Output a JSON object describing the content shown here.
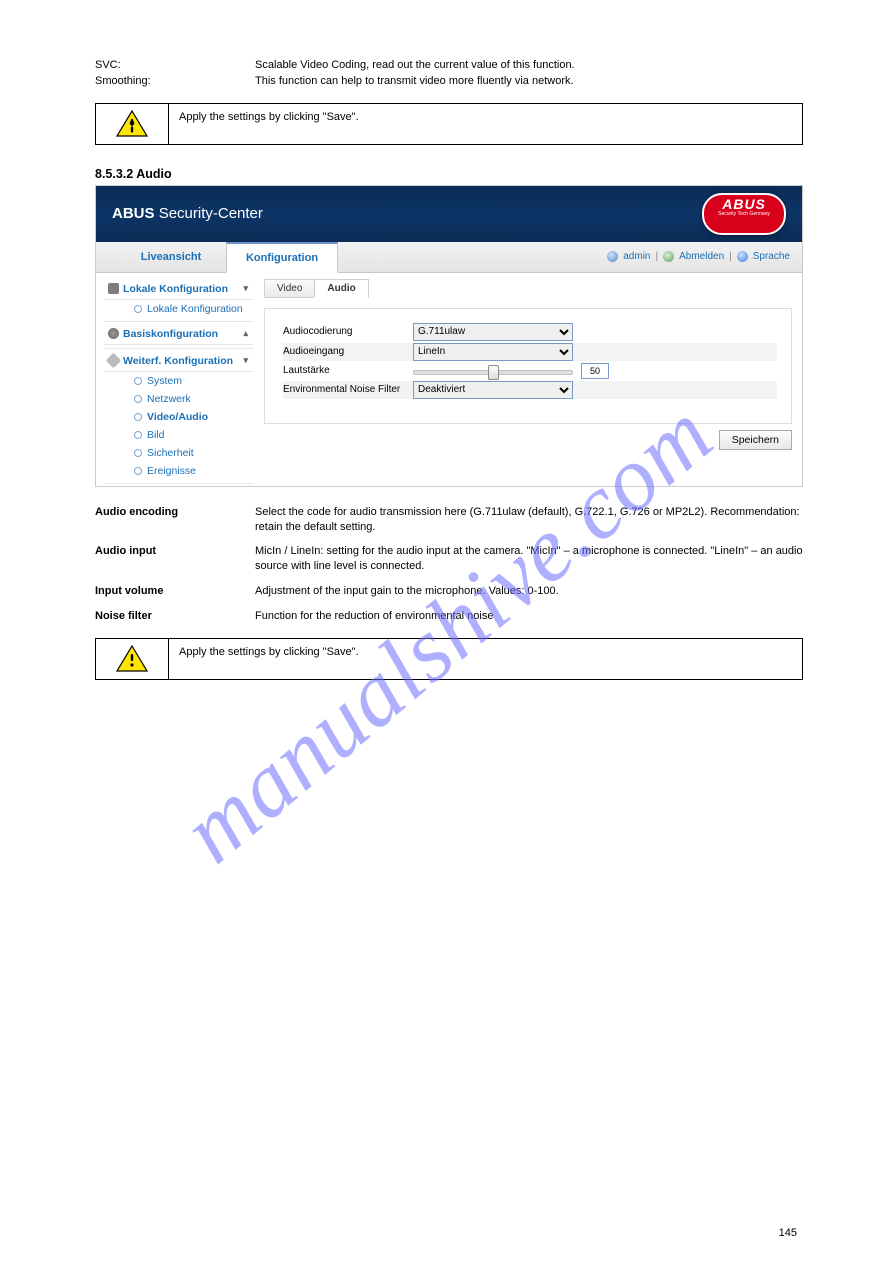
{
  "watermark": "manualshive.com",
  "top": {
    "smo": {
      "label": "SVC:",
      "value": "Scalable Video Coding, read out the current value of this function."
    },
    "smoothing": {
      "label": "Smoothing:",
      "value": "This function can help to transmit video more fluently via network."
    }
  },
  "note1": "Apply the settings by clicking \"Save\".",
  "section_heading": "8.5.3.2 Audio",
  "shot": {
    "banner": {
      "brand_bold": "ABUS",
      "brand_rest": "Security-Center",
      "logo_top": "ABUS",
      "logo_sub": "Security Tech Germany"
    },
    "tabs": {
      "live": "Liveansicht",
      "config": "Konfiguration",
      "user": "admin",
      "logout": "Abmelden",
      "lang": "Sprache"
    },
    "sidebar": {
      "local_conf": "Lokale Konfiguration",
      "local_conf_sub": "Lokale Konfiguration",
      "basic": "Basiskonfiguration",
      "adv": "Weiterf. Konfiguration",
      "adv_items": [
        "System",
        "Netzwerk",
        "Video/Audio",
        "Bild",
        "Sicherheit",
        "Ereignisse"
      ],
      "adv_active_index": 2
    },
    "subtabs": {
      "video": "Video",
      "audio": "Audio"
    },
    "form": {
      "audioenc": {
        "label": "Audiocodierung",
        "value": "G.711ulaw"
      },
      "audioin": {
        "label": "Audioeingang",
        "value": "LineIn"
      },
      "volume": {
        "label": "Lautstärke",
        "value": "50",
        "percent": 50
      },
      "noise": {
        "label": "Environmental Noise Filter",
        "value": "Deaktiviert"
      }
    },
    "save": "Speichern"
  },
  "below": {
    "audioenc": {
      "label": "Audio encoding",
      "value": "Select the code for audio transmission here (G.711ulaw (default), G.722.1, G.726 or MP2L2). Recommendation: retain the default setting."
    },
    "audioin": {
      "label": "Audio input",
      "value": "MicIn / LineIn: setting for the audio input at the camera. \"MicIn\" –  a microphone is connected. \"LineIn\" – an audio source with line level is connected."
    },
    "volume": {
      "label": "Input volume",
      "value": "Adjustment of the input gain to the microphone. Values: 0-100."
    },
    "noise": {
      "label": "Noise filter",
      "value": "Function for the reduction of environmental noise"
    }
  },
  "note2": "Apply the settings by clicking \"Save\".",
  "pagenum": "145"
}
